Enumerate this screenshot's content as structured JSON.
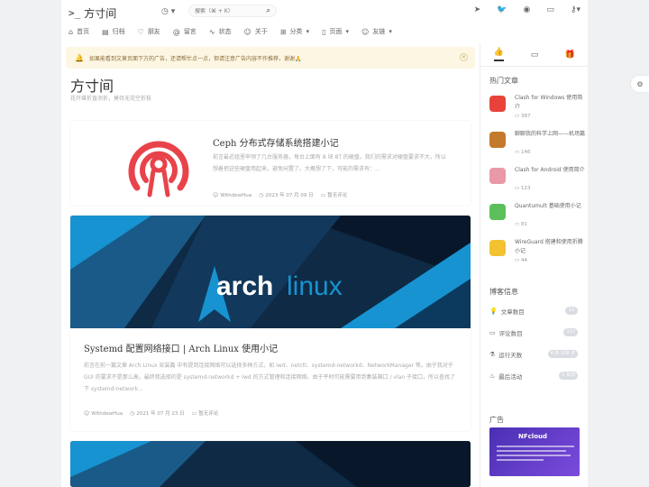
{
  "header": {
    "logo_glyph": ">_",
    "site_name": "方寸间",
    "search_placeholder": "搜索（⌘ + K）"
  },
  "nav": [
    {
      "label": "首页",
      "icon": "home-icon"
    },
    {
      "label": "归档",
      "icon": "archive-icon"
    },
    {
      "label": "朋友",
      "icon": "heart-icon"
    },
    {
      "label": "留言",
      "icon": "at-icon"
    },
    {
      "label": "状态",
      "icon": "pulse-icon"
    },
    {
      "label": "关于",
      "icon": "user-icon"
    },
    {
      "label": "分类",
      "icon": "grid-icon"
    },
    {
      "label": "页面",
      "icon": "file-icon"
    },
    {
      "label": "友链",
      "icon": "user-icon"
    }
  ],
  "notice": {
    "text": "如果能看到文章页面下方的广告，还请帮忙点一点，但请注意广告内容不作推荐，谢谢🙏"
  },
  "site": {
    "title": "方寸间",
    "subtitle": "花开堪折直须折，莫待无花空折枝"
  },
  "posts": [
    {
      "title": "Ceph 分布式存储系统搭建小记",
      "excerpt": "前言最近组里申领了几台服务器，每台上面有 8 块 8T 的硬盘。我们的需求对硬盘要求不大，所以想着把这些硬盘用起来，避免闲置了。大概想了下，可能的需求有：...",
      "author": "WithdewHua",
      "date": "2023 年 07 月 09 日",
      "comments": "暂无评论"
    },
    {
      "title": "Systemd 配置网络接口 | Arch Linux 使用小记",
      "excerpt": "前言在前一篇文章 Arch Linux 安装篇 中有提到连接网络可以选择多种方式，如 iwd、netctl、systemd-networkd、NetworkManager 等。由于我对于 GUI 的要求不是那么高，最终我选择的是 systemd-networkd + iwd 的方式管理和连接网络。由于平时可能需要用到集装箱口 / vlan 子接口，所以查找了下 systemd-network...",
      "author": "WithdewHua",
      "date": "2021 年 07 月 23 日",
      "comments": "暂无评论",
      "banner_text_1": "arch",
      "banner_text_2": "linux"
    }
  ],
  "sidebar": {
    "hot_title": "热门文章",
    "hot": [
      {
        "title": "Clash for Windows 使用简介",
        "count": "387",
        "color": "#e8433a"
      },
      {
        "title": "聊聊我的科学上网——机场篇",
        "count": "146",
        "color": "#c47a2c"
      },
      {
        "title": "Clash for Android 使用简介",
        "count": "123",
        "color": "#e99aa6"
      },
      {
        "title": "Quantumult 基础使用小记",
        "count": "81",
        "color": "#5bbf5a"
      },
      {
        "title": "WireGuard 搭建和使用折腾小记",
        "count": "44",
        "color": "#f2c230"
      }
    ],
    "info_title": "博客信息",
    "stats": [
      {
        "label": "文章数目",
        "icon": "bulb-icon",
        "value": "12"
      },
      {
        "label": "评论数目",
        "icon": "comment-icon",
        "value": "117"
      },
      {
        "label": "运行天数",
        "icon": "flask-icon",
        "value": "4 年 208 天"
      },
      {
        "label": "最后活动",
        "icon": "flame-icon",
        "value": "1 年前"
      }
    ],
    "ad_title": "广告",
    "ad_brand": "NFcloud"
  },
  "colors": {
    "ceph_red": "#e8434a",
    "arch_blue": "#1793d1",
    "banner_dark": "#0e2a44"
  }
}
